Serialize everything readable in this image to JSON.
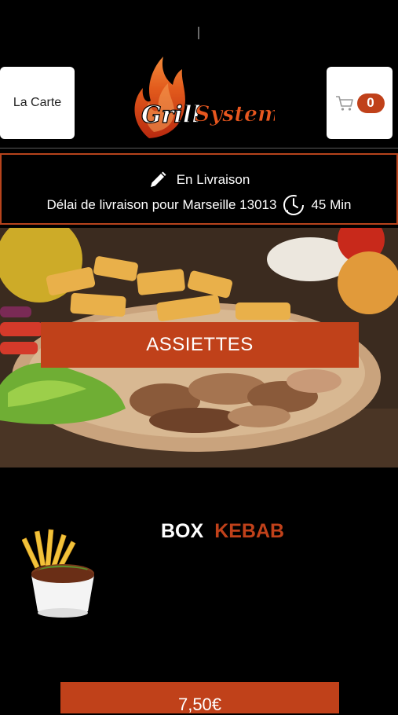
{
  "header": {
    "menu_button_label": "La Carte",
    "cart_count": "0",
    "logo_text_1": "Grill",
    "logo_text_2": "System"
  },
  "delivery": {
    "mode_label": "En Livraison",
    "delay_label": "Délai de livraison pour Marseille 13013",
    "delay_value": "45 Min"
  },
  "category": {
    "label": "ASSIETTES"
  },
  "product": {
    "name_part1": "BOX",
    "name_part2": "KEBAB",
    "price": "7,50€"
  },
  "colors": {
    "accent": "#c0411a",
    "background": "#000000"
  },
  "icons": [
    "pencil-icon",
    "clock-icon",
    "cart-icon"
  ]
}
